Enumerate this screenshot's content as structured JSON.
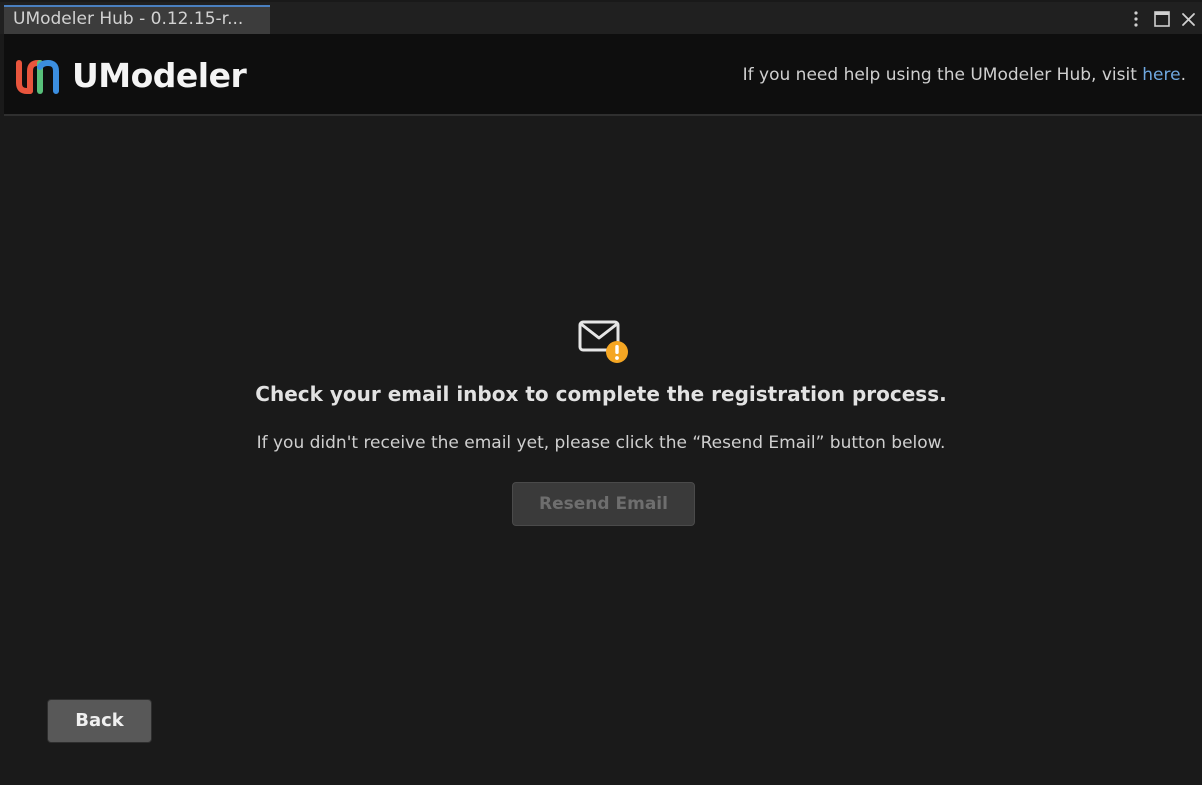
{
  "window": {
    "tab_title": "UModeler Hub - 0.12.15-r..."
  },
  "header": {
    "logo_text": "UModeler",
    "help_text": "If you need help using the UModeler Hub, visit ",
    "help_link": "here",
    "help_suffix": "."
  },
  "main": {
    "heading": "Check your email inbox to complete the registration process.",
    "subtext": "If you didn't receive the email yet, please click the “Resend Email” button below.",
    "resend_label": "Resend Email",
    "back_label": "Back"
  },
  "icons": {
    "menu": "more-vertical-icon",
    "maximize": "maximize-icon",
    "close": "close-icon",
    "mail": "mail-alert-icon"
  },
  "colors": {
    "background": "#1a1a1a",
    "header_bg": "#0e0e0e",
    "link": "#6fa8e0",
    "alert": "#f5a623",
    "logo_red": "#e8553d",
    "logo_green": "#58c07a",
    "logo_blue": "#3b8ee0"
  }
}
